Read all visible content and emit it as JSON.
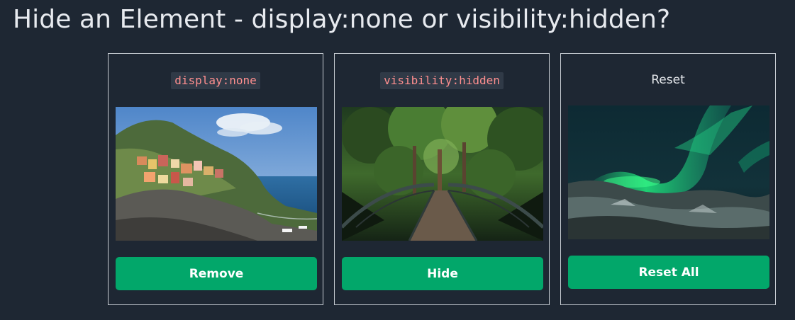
{
  "page": {
    "title": "Hide an Element - display:none or visibility:hidden?"
  },
  "cards": [
    {
      "title": "display:none",
      "title_style": "code",
      "image": "cinque-terre-coastal-village-photo",
      "button_label": "Remove"
    },
    {
      "title": "visibility:hidden",
      "title_style": "code",
      "image": "forest-footbridge-photo",
      "button_label": "Hide"
    },
    {
      "title": "Reset",
      "title_style": "plain",
      "image": "northern-lights-aurora-photo",
      "button_label": "Reset All"
    }
  ],
  "colors": {
    "background": "#1e2733",
    "button": "#02a76a",
    "code_text": "#ff8f8f",
    "code_background": "#303a47",
    "card_border": "#c7ccd3"
  }
}
